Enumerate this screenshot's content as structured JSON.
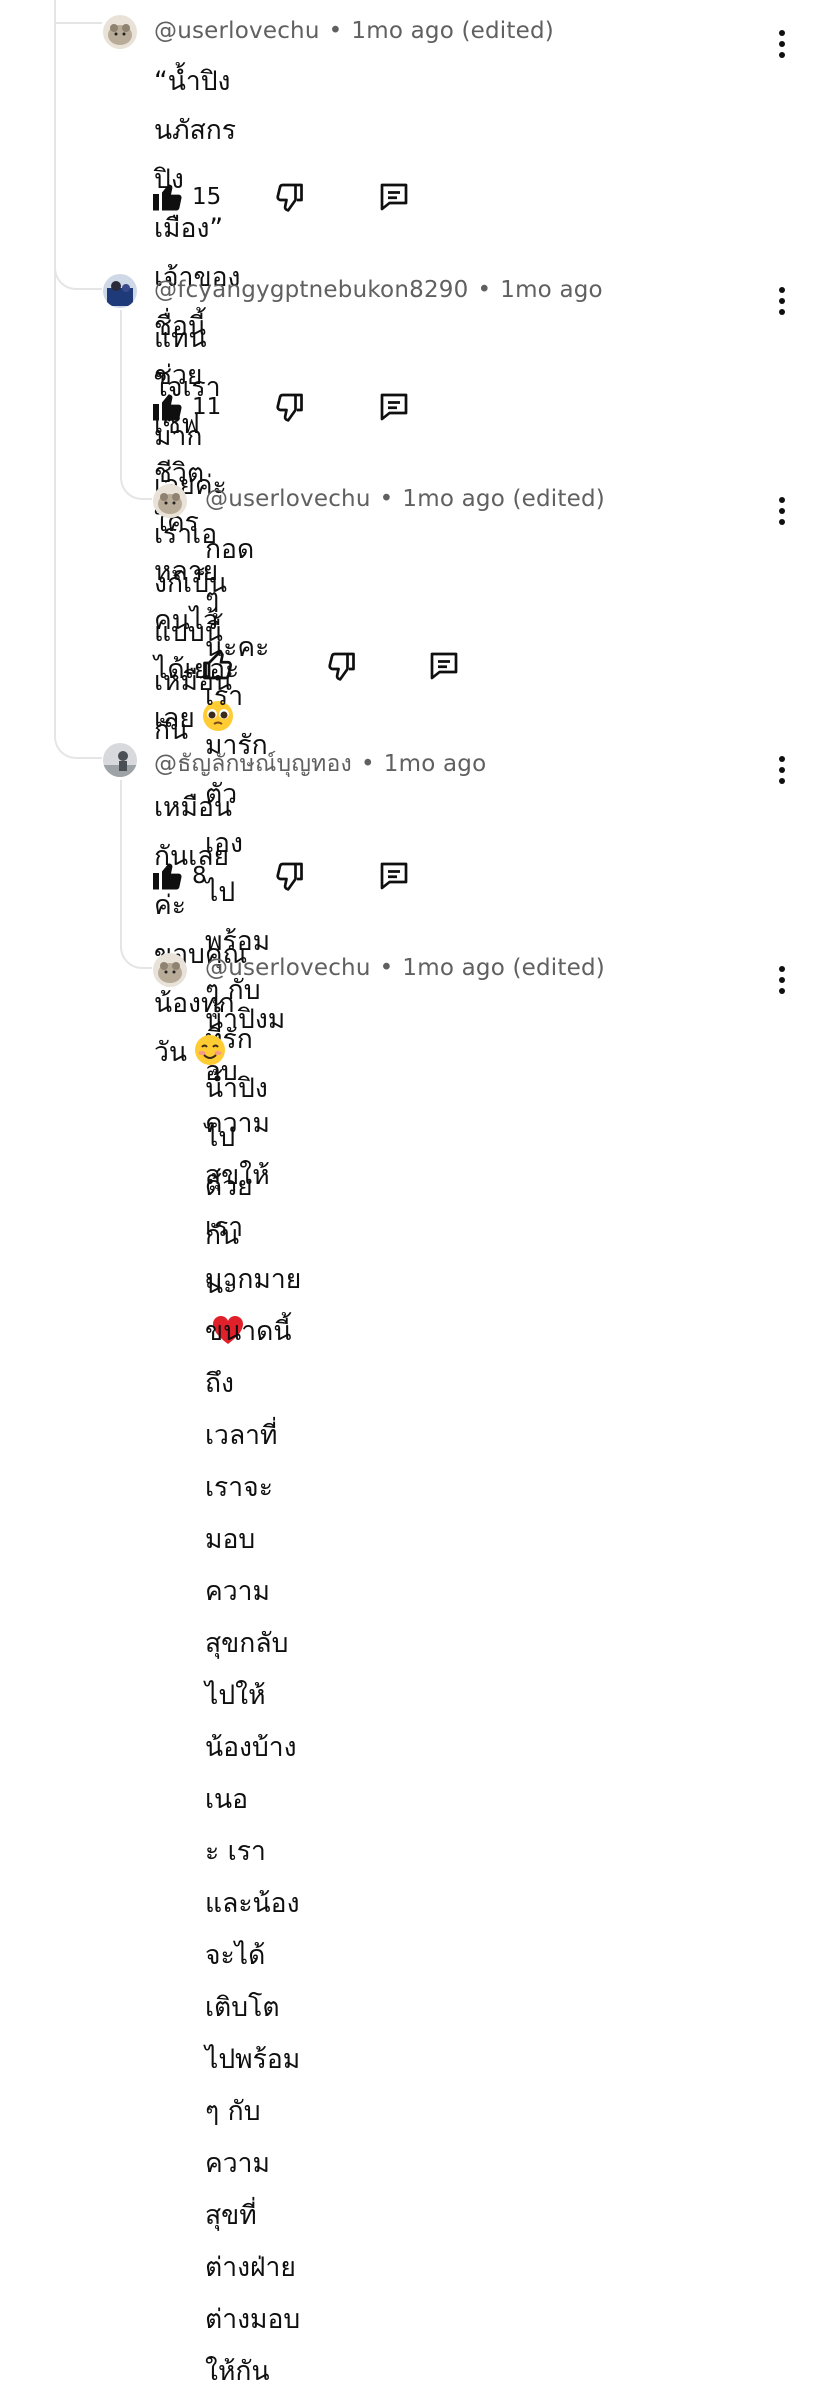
{
  "comments": [
    {
      "author": "@userlovechu",
      "time": "1mo ago",
      "edited": "(edited)",
      "text": "“น้ำปิง นภัสกร ปิงเมือง” เจ้าของชื่อนี้ช่วยเซฟชีวิต\nใครหลายคนไว้ได้เยอะเลย",
      "emoji": "pleading-face",
      "likes": "15"
    },
    {
      "author": "@fcyangygptnebukon8290",
      "time": "1mo ago",
      "edited": "",
      "text": "แทนใจเรามากเลยค่ะ เราเองก้เป็นแบบนี้เหมือนกัน",
      "likes": "11"
    },
    {
      "author": "@userlovechu",
      "time": "1mo ago",
      "edited": "(edited)",
      "text": "กอด ๆ นะคะ เรามารักตัวเองไปพร้อม ๆ กับที่รัก\nน้ำปิงไปด้วยกันนะ",
      "emoji": "red-heart",
      "likes": ""
    },
    {
      "author": "@ธัญลักษณ์บุญทอง",
      "time": "1mo ago",
      "edited": "",
      "text": "เหมือนกันเลยค่ะ ขอบคุณน้องทุกวัน",
      "emoji": "smiling-face",
      "likes": "8"
    },
    {
      "author": "@userlovechu",
      "time": "1mo ago",
      "edited": "(edited)",
      "text": "น้ำปิงมอบความสุขให้เรามากมายขนาดนี้ ถึง\nเวลาที่เราจะมอบความสุขกลับไปให้น้องบ้างเนอ\nะ เราและน้องจะได้เติบโตไปพร้อม ๆ กับความ\nสุขที่ต่างฝ่ายต่างมอบให้กันและกัน",
      "emoji": "red-heart pleading-face",
      "likes": ""
    }
  ],
  "separator": "•"
}
